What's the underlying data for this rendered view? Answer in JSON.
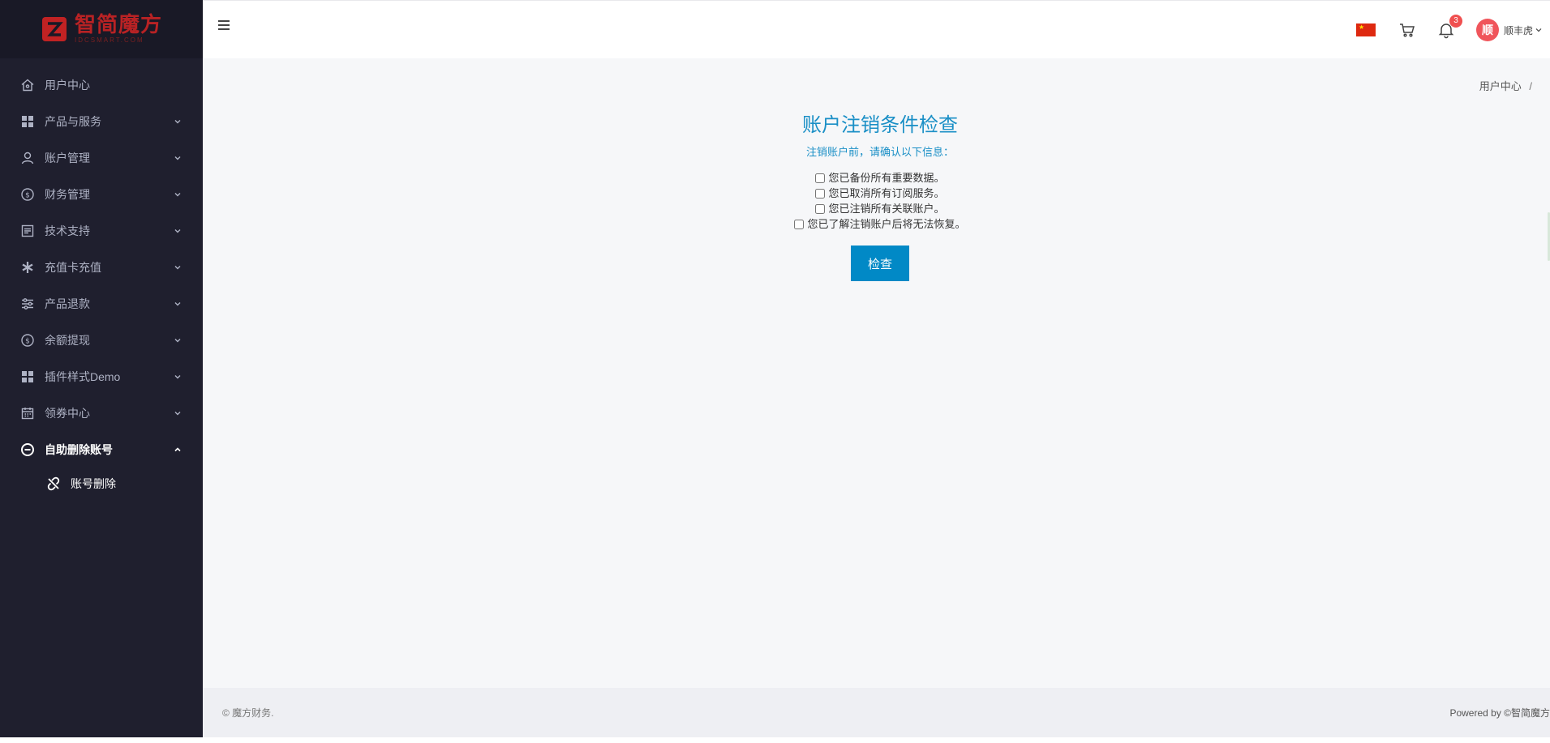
{
  "sidebar": {
    "logo": {
      "title": "智简魔方",
      "subtitle": "IDCSMART.COM"
    },
    "items": [
      {
        "label": "用户中心",
        "icon": "home-icon",
        "expandable": false
      },
      {
        "label": "产品与服务",
        "icon": "grid-icon",
        "expandable": true
      },
      {
        "label": "账户管理",
        "icon": "user-icon",
        "expandable": true
      },
      {
        "label": "财务管理",
        "icon": "dollar-circle-icon",
        "expandable": true
      },
      {
        "label": "技术支持",
        "icon": "document-icon",
        "expandable": true
      },
      {
        "label": "充值卡充值",
        "icon": "asterisk-icon",
        "expandable": true
      },
      {
        "label": "产品退款",
        "icon": "sliders-icon",
        "expandable": true
      },
      {
        "label": "余额提现",
        "icon": "dollar-circle-icon",
        "expandable": true
      },
      {
        "label": "插件样式Demo",
        "icon": "grid-icon",
        "expandable": true
      },
      {
        "label": "领券中心",
        "icon": "calendar-icon",
        "expandable": true
      },
      {
        "label": "自助删除账号",
        "icon": "minus-circle-icon",
        "expandable": true,
        "expanded": true
      }
    ],
    "submenu": [
      {
        "label": "账号删除",
        "icon": "unlink-icon"
      }
    ]
  },
  "header": {
    "notification_count": "3",
    "user": {
      "avatar_text": "顺",
      "name": "顺丰虎"
    },
    "colors": {
      "flag": "#de2910",
      "badge": "#f05050",
      "avatar": "#f0555b"
    }
  },
  "breadcrumb": {
    "current": "用户中心",
    "separator": "/"
  },
  "page": {
    "title": "账户注销条件检查",
    "subtitle": "注销账户前，请确认以下信息：",
    "checks": [
      {
        "label": "您已备份所有重要数据。",
        "checked": false
      },
      {
        "label": "您已取消所有订阅服务。",
        "checked": false
      },
      {
        "label": "您已注销所有关联账户。",
        "checked": false
      },
      {
        "label": "您已了解注销账户后将无法恢复。",
        "checked": false
      }
    ],
    "button_label": "检查",
    "accent_color": "#1a8fc6",
    "button_color": "#0189c6"
  },
  "footer": {
    "left": "© 魔方财务.",
    "right": "Powered by ©智简魔方"
  }
}
